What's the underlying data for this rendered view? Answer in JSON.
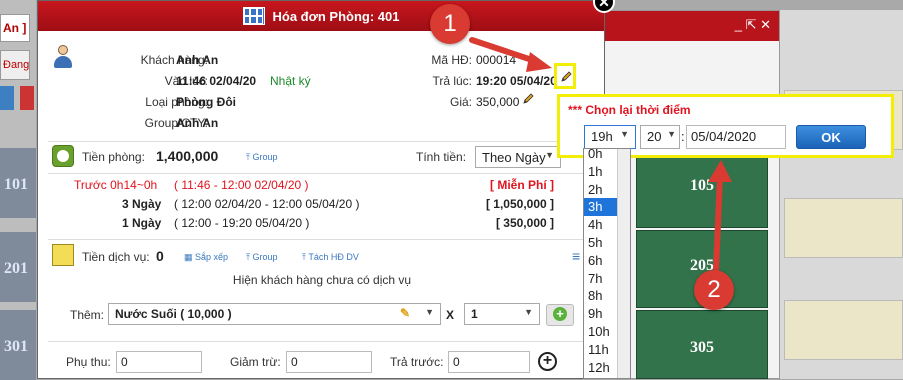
{
  "background": {
    "left_tab_header": "An ]",
    "left_tab_mini": "Đang",
    "left_rooms": [
      "101",
      "201",
      "301"
    ],
    "right_window_controls": "_ ⇱ ✕",
    "green_rooms": [
      "105",
      "205",
      "305"
    ]
  },
  "dialog": {
    "title": "Hóa đơn Phòng: 401",
    "close_label": "✕",
    "customer_label": "Khách hàng:",
    "customer_value": "Anh An",
    "checkin_label": "Vào lúc:",
    "checkin_value": "11:46 02/04/20",
    "checkin_log": "Nhật ký",
    "room_type_label": "Loại phòng:",
    "room_type_value": "Phòng Đôi",
    "group_label": "Group/CTY:",
    "group_value": "Anh An",
    "invoice_code_label": "Mã HĐ:",
    "invoice_code_value": "000014",
    "checkout_label": "Trả lúc:",
    "checkout_value": "19:20 05/04/20",
    "price_label": "Giá:",
    "price_value": "350,000",
    "room_charge_label": "Tiền phòng:",
    "room_charge_value": "1,400,000",
    "group_link": "Group",
    "billing_label": "Tính tiền:",
    "billing_select": "Theo Ngày",
    "charge_rows": [
      {
        "desc": "Trước 0h14~0h",
        "period": "( 11:46 - 12:00 02/04/20 )",
        "amount": "[ Miễn Phí ]",
        "red": true
      },
      {
        "desc": "3 Ngày",
        "period": "( 12:00 02/04/20 - 12:00 05/04/20 )",
        "amount": "[ 1,050,000 ]",
        "red": false
      },
      {
        "desc": "1 Ngày",
        "period": "( 12:00 - 19:20 05/04/20 )",
        "amount": "[ 350,000 ]",
        "red": false
      }
    ],
    "service_label": "Tiền dịch vụ:",
    "service_value": "0",
    "sort_link": "Sắp xếp",
    "group_link2": "Group",
    "split_link": "Tách HĐ DV",
    "no_service_text": "Hiện khách hàng chưa có dịch vụ",
    "add_label": "Thêm:",
    "add_item": "Nước Suối ( 10,000 )",
    "multiply": "X",
    "quantity": "1",
    "surcharge_label": "Phụ thu:",
    "surcharge_value": "0",
    "discount_label": "Giảm trừ:",
    "discount_value": "0",
    "prepaid_label": "Trả trước:",
    "prepaid_value": "0"
  },
  "popup": {
    "title": "*** Chọn lại thời điểm",
    "hour": "19h",
    "minute": "20",
    "colon": ":",
    "date": "05/04/2020",
    "ok": "OK"
  },
  "hour_list": [
    "0h",
    "1h",
    "2h",
    "3h",
    "4h",
    "5h",
    "6h",
    "7h",
    "8h",
    "9h",
    "10h",
    "11h",
    "12h"
  ],
  "hour_list_selected": "3h",
  "annotations": {
    "step1": "1",
    "step2": "2"
  },
  "colors": {
    "header_red": "#b8141c",
    "highlight_yellow": "#f2ee07",
    "ok_blue": "#1b63b8",
    "room_green": "#33734b",
    "badge_red": "#d93a31"
  }
}
